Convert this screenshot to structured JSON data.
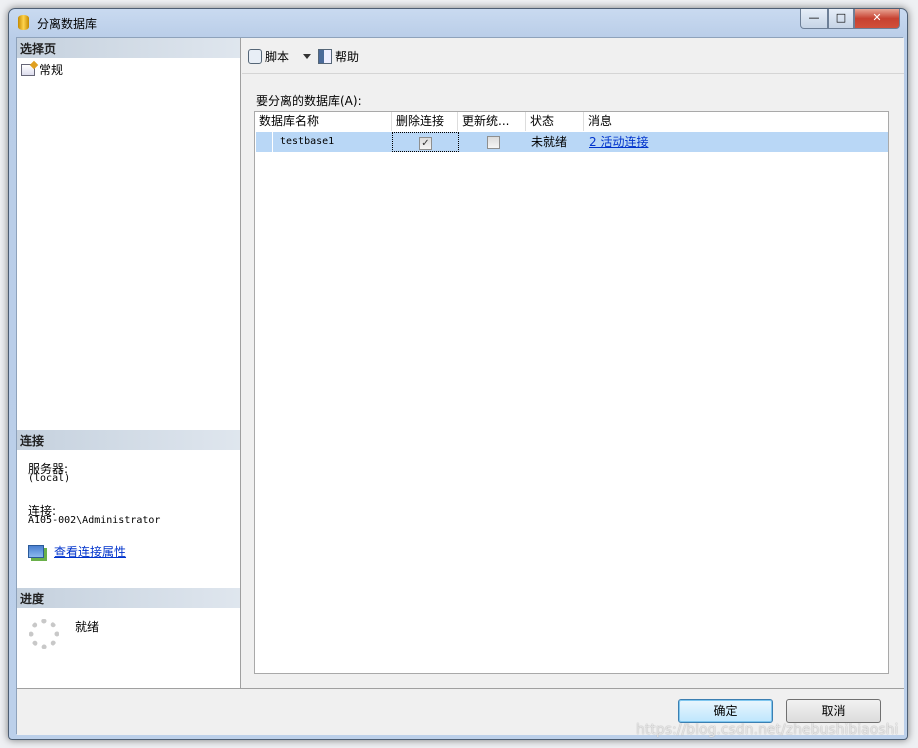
{
  "window": {
    "title": "分离数据库",
    "minimize": "—",
    "maximize": "□",
    "close": "✕"
  },
  "sidebar": {
    "select_page_header": "选择页",
    "pages": [
      {
        "label": "常规",
        "icon": "general-page-icon"
      }
    ],
    "connection_header": "连接",
    "server_label": "服务器:",
    "server_value": "(local)",
    "connection_label": "连接:",
    "connection_value": "A105-002\\Administrator",
    "view_properties_link": "查看连接属性",
    "progress_header": "进度",
    "progress_status": "就绪"
  },
  "toolbar": {
    "script_label": "脚本",
    "help_label": "帮助"
  },
  "main": {
    "grid_label": "要分离的数据库(A):",
    "columns": [
      "数据库名称",
      "删除连接",
      "更新统...",
      "状态",
      "消息"
    ],
    "rows": [
      {
        "name": "testbase1",
        "drop_connections": true,
        "update_statistics": false,
        "status": "未就绪",
        "message": "2 活动连接"
      }
    ]
  },
  "buttons": {
    "ok": "确定",
    "cancel": "取消"
  },
  "watermark": "https://blog.csdn.net/zhebushibiaoshi"
}
